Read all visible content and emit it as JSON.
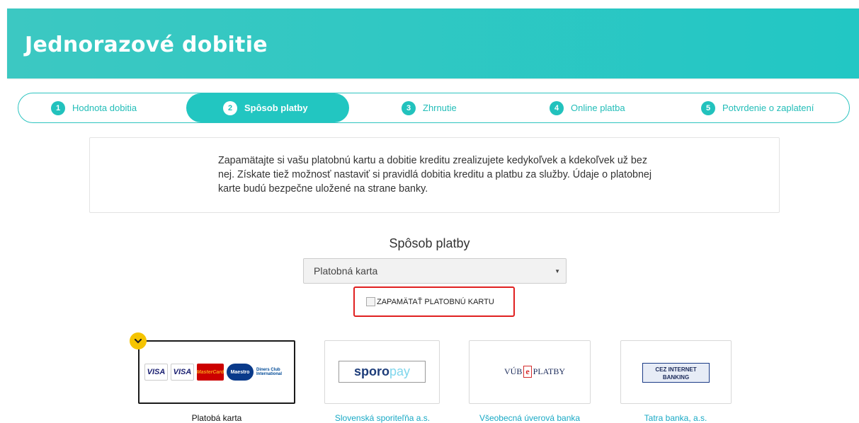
{
  "header": {
    "title": "Jednorazové dobitie"
  },
  "steps": [
    {
      "num": "1",
      "label": "Hodnota dobitia"
    },
    {
      "num": "2",
      "label": "Spôsob platby"
    },
    {
      "num": "3",
      "label": "Zhrnutie"
    },
    {
      "num": "4",
      "label": "Online platba"
    },
    {
      "num": "5",
      "label": "Potvrdenie o zaplatení"
    }
  ],
  "info": {
    "text": "Zapamätajte si vašu platobnú kartu a dobitie kreditu zrealizujete kedykoľvek a kdekoľvek už bez nej. Získate tiež možnosť nastaviť si pravidlá dobitia kreditu a platbu za služby. Údaje o platobnej karte budú bezpečne uložené na strane banky."
  },
  "payment": {
    "section_title": "Spôsob platby",
    "select_value": "Platobná karta",
    "remember_label": "ZAPAMÄTAŤ PLATOBNÚ KARTU"
  },
  "methods": [
    {
      "name": "Platobá karta",
      "logo_labels": [
        "VISA",
        "VISA",
        "MasterCard",
        "Maestro",
        "Diners Club International"
      ]
    },
    {
      "name": "Slovenská sporiteľňa a.s.",
      "logo_bold": "sporo",
      "logo_light": "pay"
    },
    {
      "name": "Všeobecná úverová banka",
      "logo_left": "VÚB",
      "logo_e": "e",
      "logo_right": "PLATBY"
    },
    {
      "name": "Tatra banka, a.s.",
      "logo_text": "CEZ INTERNET BANKING"
    }
  ],
  "colors": {
    "accent": "#22c6c1",
    "link": "#18a9c5",
    "highlight": "#e02020",
    "check": "#f5c400"
  }
}
